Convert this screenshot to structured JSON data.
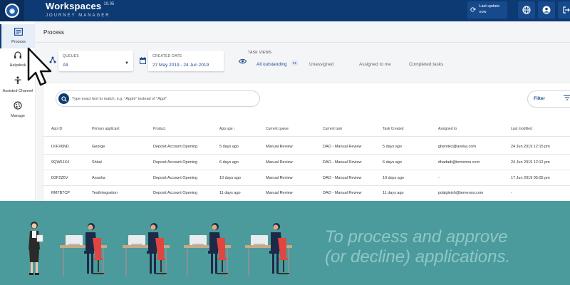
{
  "header": {
    "title": "Workspaces",
    "version": "19.05",
    "subtitle": "JOURNEY MANAGER",
    "last_update": [
      "Last update",
      "now"
    ],
    "icons": [
      "refresh-icon",
      "globe-icon",
      "user-icon",
      "logout-icon"
    ]
  },
  "sidebar": {
    "items": [
      {
        "label": "Process",
        "icon": "process-icon",
        "active": true
      },
      {
        "label": "Helpdesk",
        "icon": "headset-icon"
      },
      {
        "label": "Assisted Channel",
        "icon": "person-icon"
      },
      {
        "label": "Manage",
        "icon": "palette-icon"
      }
    ]
  },
  "page": {
    "title": "Process"
  },
  "filters": {
    "queues_label": "QUEUES",
    "queues_value": "All",
    "created_label": "CREATED DATE",
    "created_value": "27 May 2019 - 24 Jun 2019"
  },
  "task_views": {
    "label": "TASK VIEWS",
    "tabs": [
      "All outstanding",
      "Unassigned",
      "Assigned to me",
      "Completed tasks"
    ],
    "badge": "21",
    "active_index": 0
  },
  "search": {
    "placeholder": "Type exact text to match, e.g. \"Apple\" instead of \"Appl\""
  },
  "filter_button": "Filter",
  "table": {
    "columns": [
      "App ID",
      "Primary applicant",
      "Product",
      "App age ↓",
      "Current queue",
      "Current task",
      "Task Created",
      "Assigned to",
      "Last modified"
    ],
    "rows": [
      [
        "LKFX6ND",
        "George",
        "Deposit Account Opening",
        "5 days ago",
        "Manual Review",
        "DAO - Manual Review",
        "5 days ago",
        "gbenitez@avoka.com",
        "24 Jun 2019 12:15 pm"
      ],
      [
        "9QW5JX4",
        "Shital",
        "Deposit Account Opening",
        "6 days ago",
        "Manual Review",
        "DAO - Manual Review",
        "6 days ago",
        "dhadadi@temenos.com",
        "24 Jun 2019 12:12 pm"
      ],
      [
        "D2F2Z6V",
        "Anusha",
        "Deposit Account Opening",
        "10 days ago",
        "Manual Review",
        "DAO - Manual Review",
        "10 days ago",
        "-",
        "17 Jun 2019 05:05 pm"
      ],
      [
        "RM7B7CP",
        "TestIntegration",
        "Deposit Account Opening",
        "11 days ago",
        "Manual Review",
        "DAO - Manual Review",
        "11 days ago",
        "pdalgleish@temenos.com",
        "-"
      ]
    ]
  },
  "banner": {
    "text_lines": [
      "To process and approve",
      "(or decline) applications."
    ],
    "bg_color": "#4c9b9c",
    "text_color": "#8fc7c6"
  },
  "colors": {
    "header": "#0d3a72",
    "accent": "#1f4d8f",
    "chair": "#e0463f"
  }
}
